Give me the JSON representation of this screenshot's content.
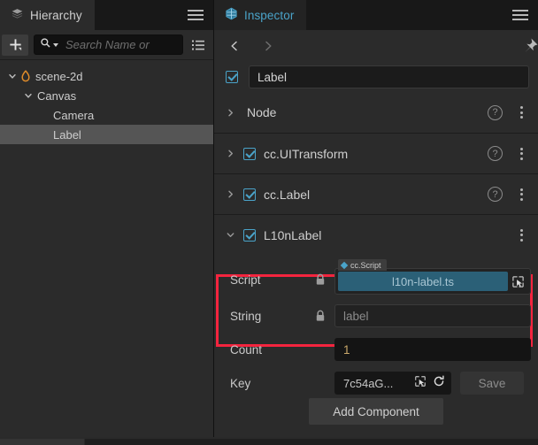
{
  "hierarchy": {
    "tab": {
      "label": "Hierarchy",
      "icon": "layers-icon"
    },
    "menu_icon": "hamburger-menu-icon",
    "toolbar": {
      "add_icon": "add-node-icon",
      "search_icon": "search-icon",
      "search_placeholder": "Search Name or",
      "list_icon": "list-view-icon"
    },
    "tree": [
      {
        "label": "scene-2d",
        "depth": 0,
        "expanded": true,
        "icon": "flame-icon",
        "selected": false,
        "twisty": "chevron-down-icon"
      },
      {
        "label": "Canvas",
        "depth": 1,
        "expanded": true,
        "icon": "",
        "selected": false,
        "twisty": "chevron-down-icon"
      },
      {
        "label": "Camera",
        "depth": 2,
        "expanded": false,
        "icon": "",
        "selected": false,
        "twisty": ""
      },
      {
        "label": "Label",
        "depth": 2,
        "expanded": false,
        "icon": "",
        "selected": true,
        "twisty": ""
      }
    ]
  },
  "inspector": {
    "tab": {
      "label": "Inspector",
      "icon": "cube-icon"
    },
    "menu_icon": "hamburger-menu-icon",
    "nav": {
      "back_icon": "chevron-left-icon",
      "forward_icon": "chevron-right-icon",
      "pin_icon": "pin-icon"
    },
    "node": {
      "enabled": true,
      "name": "Label"
    },
    "components": [
      {
        "name": "Node",
        "expanded": false,
        "twisty": "chevron-right-icon",
        "has_checkbox": false,
        "checked": false,
        "has_help": true,
        "menu_icon": "kebab-menu-icon",
        "highlighted": false
      },
      {
        "name": "cc.UITransform",
        "expanded": false,
        "twisty": "chevron-right-icon",
        "has_checkbox": true,
        "checked": true,
        "has_help": true,
        "menu_icon": "kebab-menu-icon",
        "highlighted": false
      },
      {
        "name": "cc.Label",
        "expanded": false,
        "twisty": "chevron-right-icon",
        "has_checkbox": true,
        "checked": true,
        "has_help": true,
        "menu_icon": "kebab-menu-icon",
        "highlighted": true
      },
      {
        "name": "L10nLabel",
        "expanded": true,
        "twisty": "chevron-down-icon",
        "has_checkbox": true,
        "checked": true,
        "has_help": false,
        "menu_icon": "kebab-menu-icon",
        "highlighted": true
      }
    ],
    "properties": {
      "script": {
        "label": "Script",
        "locked": true,
        "lock_icon": "lock-icon",
        "badge": "cc.Script",
        "badge_icon": "diamond-icon",
        "value": "l10n-label.ts",
        "picker_icon": "node-picker-icon"
      },
      "string": {
        "label": "String",
        "locked": true,
        "lock_icon": "lock-icon",
        "placeholder": "label",
        "value": ""
      },
      "count": {
        "label": "Count",
        "locked": false,
        "value": "1"
      },
      "key": {
        "label": "Key",
        "locked": false,
        "value": "7c54aG...",
        "picker_icon": "node-picker-icon",
        "refresh_icon": "refresh-icon",
        "save_label": "Save"
      }
    },
    "add_component_label": "Add Component"
  },
  "colors": {
    "accent_blue": "#4aa3c9",
    "highlight_red": "#f4243e",
    "script_field": "#2b6077",
    "panel_bg": "#2b2b2b",
    "tabbar_bg": "#181818",
    "selection": "#555555",
    "flame_orange": "#e08c2a"
  }
}
